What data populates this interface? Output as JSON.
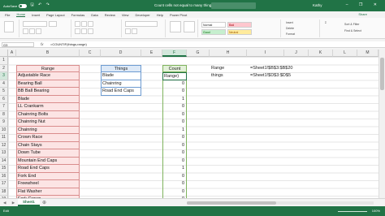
{
  "titlebar": {
    "autosave_label": "AutoSave",
    "autosave_state": "Off",
    "doc_title": "Count cells not equal to many things.xlsx",
    "user": "Kathy",
    "window_controls": "–  ❐  ✕"
  },
  "tabs": [
    "File",
    "Home",
    "Insert",
    "Page Layout",
    "Formulas",
    "Data",
    "Review",
    "View",
    "Developer",
    "Help",
    "Power Pivot"
  ],
  "active_tab": "Home",
  "share_label": "Share",
  "ribbon": {
    "styles": [
      "Normal",
      "Bad",
      "Good",
      "Neutral"
    ],
    "side_items": [
      "Insert",
      "Delete",
      "Format"
    ],
    "edit_items": [
      "Sort & Filter",
      "Find & Select"
    ]
  },
  "formula_bar": {
    "name_box": "G3",
    "fx": "fx",
    "formula": "=COUNTIF(things,range)"
  },
  "columns": [
    "A",
    "B",
    "C",
    "D",
    "E",
    "F",
    "G",
    "H",
    "I",
    "J",
    "K",
    "L",
    "M",
    "N"
  ],
  "rows": [
    "1",
    "2",
    "3",
    "4",
    "5",
    "6",
    "7",
    "8",
    "9",
    "10",
    "11",
    "12",
    "13",
    "14",
    "15",
    "16",
    "17",
    "18",
    "19",
    "20"
  ],
  "selected_column": "F",
  "selected_row": "3",
  "range_table": {
    "header": "Range",
    "items": [
      "Adjustable Race",
      "Bearing Ball",
      "BB Ball Bearing",
      "Blade",
      "LL Crankarm",
      "Chainring Bolts",
      "Chainring Nut",
      "Chainring",
      "Crown Race",
      "Chain Stays",
      "Down Tube",
      "Mountain End Caps",
      "Road End Caps",
      "Fork End",
      "Freewheel",
      "Flat Washer",
      "Fork Crown",
      "Front Derailleur Cage"
    ]
  },
  "things_table": {
    "header": "Things",
    "items": [
      "Blade",
      "Chainring",
      "Road End Caps"
    ]
  },
  "count_table": {
    "header": "Count",
    "editing_text": "Range)",
    "values": [
      "",
      "0",
      "0",
      "1",
      "0",
      "0",
      "0",
      "1",
      "0",
      "0",
      "0",
      "0",
      "1",
      "0",
      "0",
      "0",
      "0",
      "0"
    ]
  },
  "notes": [
    {
      "label": "Range",
      "value": "=Sheet1!$B$3:$B$20"
    },
    {
      "label": "things",
      "value": "=Sheet1!$D$3:$D$5"
    }
  ],
  "sheet_tab": "Sheet1",
  "status": {
    "mode": "Edit",
    "zoom": "100%"
  }
}
